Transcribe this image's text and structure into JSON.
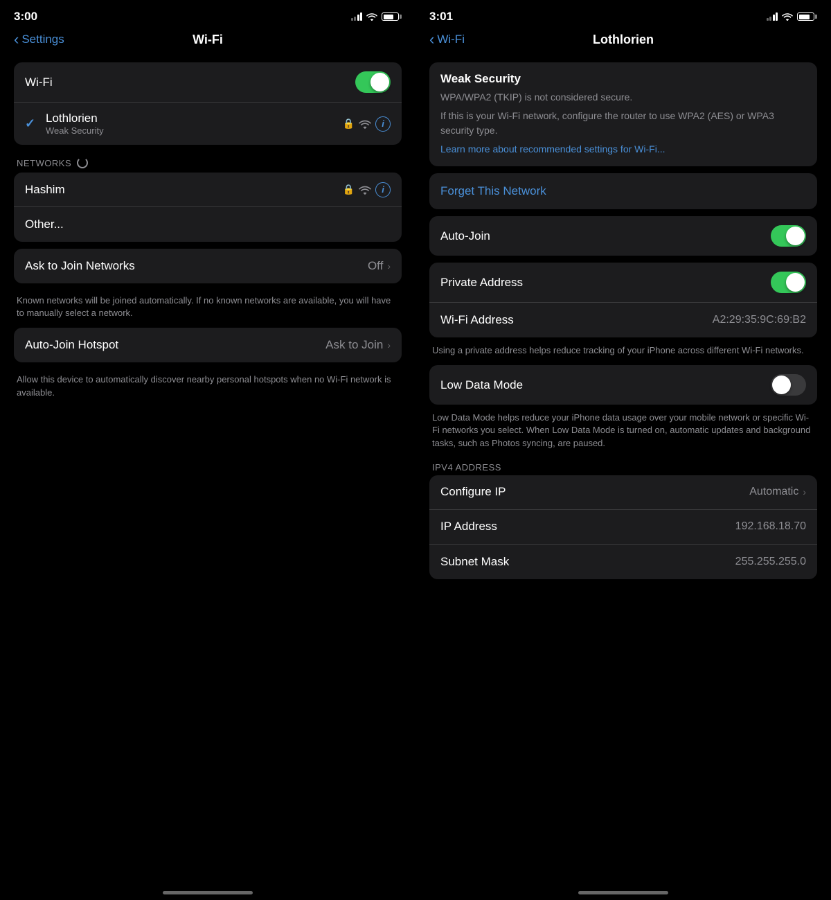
{
  "left": {
    "status": {
      "time": "3:00"
    },
    "nav": {
      "back_label": "Settings",
      "title": "Wi-Fi"
    },
    "wifi_toggle_row": {
      "label": "Wi-Fi",
      "enabled": true
    },
    "connected_network": {
      "name": "Lothlorien",
      "subtitle": "Weak Security"
    },
    "networks_section_label": "NETWORKS",
    "networks": [
      {
        "name": "Hashim"
      },
      {
        "name": "Other..."
      }
    ],
    "ask_join": {
      "label": "Ask to Join Networks",
      "value": "Off"
    },
    "ask_join_desc": "Known networks will be joined automatically. If no known networks are available, you will have to manually select a network.",
    "auto_join_hotspot": {
      "label": "Auto-Join Hotspot",
      "value": "Ask to Join"
    },
    "auto_join_hotspot_desc": "Allow this device to automatically discover nearby personal hotspots when no Wi-Fi network is available."
  },
  "right": {
    "status": {
      "time": "3:01"
    },
    "nav": {
      "back_label": "Wi-Fi",
      "title": "Lothlorien"
    },
    "weak_security": {
      "title": "Weak Security",
      "body1": "WPA/WPA2 (TKIP) is not considered secure.",
      "body2": "If this is your Wi-Fi network, configure the router to use WPA2 (AES) or WPA3 security type.",
      "link": "Learn more about recommended settings for Wi-Fi..."
    },
    "forget": {
      "label": "Forget This Network"
    },
    "auto_join": {
      "label": "Auto-Join",
      "enabled": true
    },
    "private_address": {
      "label": "Private Address",
      "enabled": true
    },
    "wifi_address": {
      "label": "Wi-Fi Address",
      "value": "A2:29:35:9C:69:B2"
    },
    "private_address_desc": "Using a private address helps reduce tracking of your iPhone across different Wi-Fi networks.",
    "low_data_mode": {
      "label": "Low Data Mode",
      "enabled": false
    },
    "low_data_desc": "Low Data Mode helps reduce your iPhone data usage over your mobile network or specific Wi-Fi networks you select. When Low Data Mode is turned on, automatic updates and background tasks, such as Photos syncing, are paused.",
    "ipv4_label": "IPV4 ADDRESS",
    "configure_ip": {
      "label": "Configure IP",
      "value": "Automatic"
    },
    "ip_address": {
      "label": "IP Address",
      "value": "192.168.18.70"
    },
    "subnet_mask": {
      "label": "Subnet Mask",
      "value": "255.255.255.0"
    }
  },
  "icons": {
    "chevron": "›",
    "back_chevron": "‹",
    "check": "✓",
    "lock": "🔒",
    "info_i": "i"
  }
}
